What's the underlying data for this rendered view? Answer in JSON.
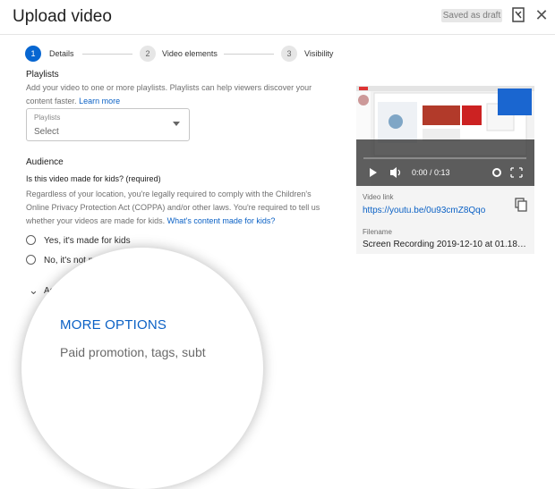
{
  "header": {
    "title": "Upload video",
    "saved_label": "Saved as draft",
    "close_symbol": "✕"
  },
  "steps": [
    {
      "number": "1",
      "label": "Details"
    },
    {
      "number": "2",
      "label": "Video elements"
    },
    {
      "number": "3",
      "label": "Visibility"
    }
  ],
  "playlists": {
    "title": "Playlists",
    "description": "Add your video to one or more playlists. Playlists can help viewers discover your content faster.",
    "learn_more": "Learn more",
    "select_label": "Playlists",
    "select_value": "Select"
  },
  "audience": {
    "title": "Audience",
    "question": "Is this video made for kids? (required)",
    "description": "Regardless of your location, you're legally required to comply with the Children's Online Privacy Protection Act (COPPA) and/or other laws. You're required to tell us whether your videos are made for kids.",
    "link": "What's content made for kids?",
    "option_yes": "Yes, it's made for kids",
    "option_no": "No, it's not made for kids"
  },
  "age": {
    "label": "Age",
    "chevron": "⌄"
  },
  "more_options": {
    "title": "MORE OPTIONS",
    "subtitle": "Paid promotion, tags, subt",
    "partial_link": "M"
  },
  "video": {
    "time": "0:00 / 0:13",
    "link_label": "Video link",
    "link_url": "https://youtu.be/0u93cmZ8Qqo",
    "filename_label": "Filename",
    "filename": "Screen Recording 2019-12-10 at 01.18…"
  },
  "colors": {
    "accent": "#0766d1",
    "link": "#0b61c5"
  }
}
